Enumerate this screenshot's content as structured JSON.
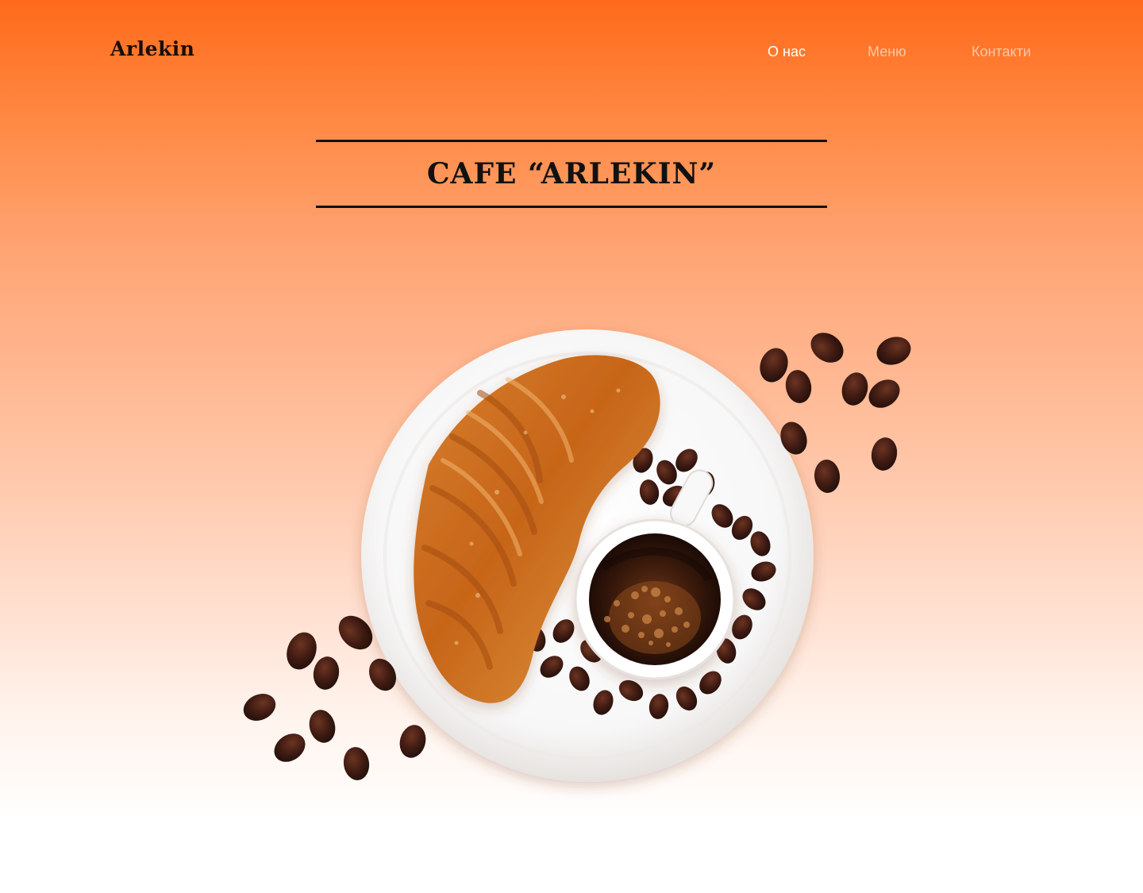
{
  "header": {
    "logo": "Arlekin",
    "nav": [
      {
        "label": "О нас",
        "active": true
      },
      {
        "label": "Меню",
        "active": false
      },
      {
        "label": "Контакти",
        "active": false
      }
    ]
  },
  "hero": {
    "title": "CAFE “ARLEKIN”"
  },
  "colors": {
    "accent": "#ff6a1a",
    "text_dark": "#111111",
    "nav_active": "#ffffff",
    "nav_inactive": "#ffc7a6"
  },
  "image": {
    "icon": "croissant-coffee-illustration"
  }
}
